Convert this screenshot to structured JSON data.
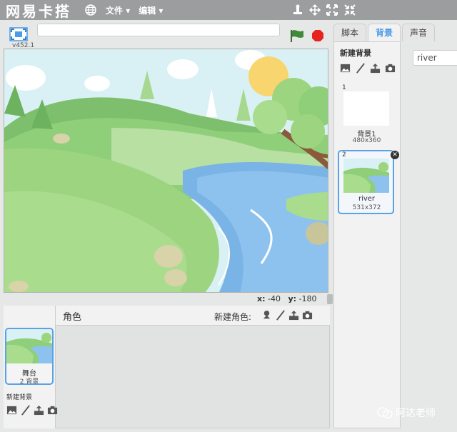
{
  "app": {
    "title": "网易卡搭",
    "version": "v452.1"
  },
  "menu": {
    "file": "文件",
    "edit": "编辑"
  },
  "stage": {
    "x_label": "x:",
    "x_value": "-40",
    "y_label": "y:",
    "y_value": "-180"
  },
  "sprites": {
    "title": "角色",
    "new_sprite": "新建角色:"
  },
  "stage_item": {
    "name": "舞台",
    "count": "2 背景",
    "new_bg": "新建背景"
  },
  "tabs": {
    "scripts": "脚本",
    "backdrops": "背景",
    "sounds": "声音",
    "active": "背景"
  },
  "backdrops": {
    "new_bg": "新建背景",
    "items": [
      {
        "num": "1",
        "name": "背景1",
        "size": "480x360"
      },
      {
        "num": "2",
        "name": "river",
        "size": "531x372"
      }
    ]
  },
  "editor": {
    "name_value": "river"
  },
  "watermark": {
    "text": "阿达老师"
  },
  "colors": {
    "accent": "#4c9be6",
    "menubar": "#9b9d9e",
    "stop": "#e6231e",
    "flag": "#3d8a3a"
  }
}
